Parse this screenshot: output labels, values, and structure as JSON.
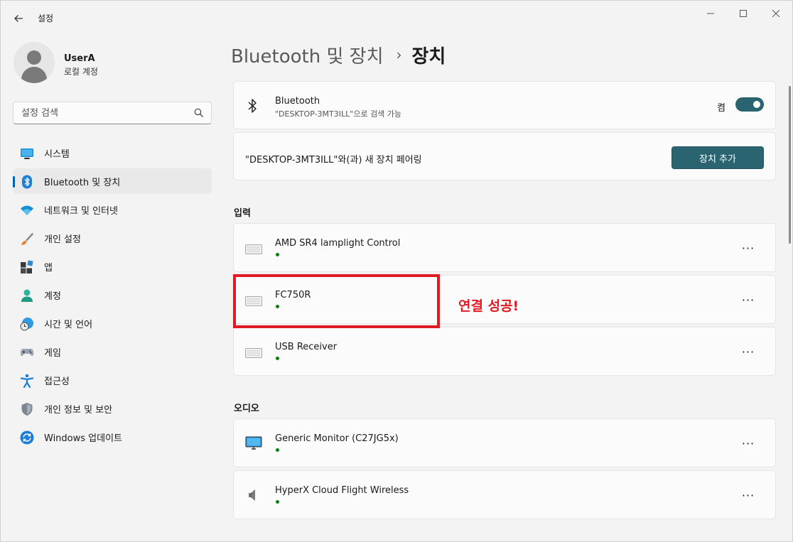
{
  "window": {
    "title": "설정",
    "back_icon": "arrow-left-icon",
    "controls": [
      "minimize-icon",
      "maximize-icon",
      "close-icon"
    ]
  },
  "user": {
    "name": "UserA",
    "account_type": "로컬 계정"
  },
  "search": {
    "placeholder": "설정 검색"
  },
  "nav": {
    "items": [
      {
        "label": "시스템",
        "icon": "system-icon",
        "active": false
      },
      {
        "label": "Bluetooth 및 장치",
        "icon": "bluetooth-icon",
        "active": true
      },
      {
        "label": "네트워크 및 인터넷",
        "icon": "wifi-icon",
        "active": false
      },
      {
        "label": "개인 설정",
        "icon": "brush-icon",
        "active": false
      },
      {
        "label": "앱",
        "icon": "apps-icon",
        "active": false
      },
      {
        "label": "계정",
        "icon": "account-icon",
        "active": false
      },
      {
        "label": "시간 및 언어",
        "icon": "time-language-icon",
        "active": false
      },
      {
        "label": "게임",
        "icon": "gamepad-icon",
        "active": false
      },
      {
        "label": "접근성",
        "icon": "accessibility-icon",
        "active": false
      },
      {
        "label": "개인 정보 및 보안",
        "icon": "shield-icon",
        "active": false
      },
      {
        "label": "Windows 업데이트",
        "icon": "update-icon",
        "active": false
      }
    ]
  },
  "breadcrumb": {
    "parent": "Bluetooth 및 장치",
    "separator": "›",
    "current": "장치"
  },
  "bluetooth": {
    "title": "Bluetooth",
    "subtitle": "\"DESKTOP-3MT3ILL\"으로 검색 가능",
    "toggle_label": "켬",
    "toggle_on": true
  },
  "pairing": {
    "text": "\"DESKTOP-3MT3ILL\"와(과) 새 장치 페어링",
    "button": "장치 추가"
  },
  "sections": {
    "input": {
      "title": "입력",
      "devices": [
        {
          "name": "AMD SR4 lamplight Control",
          "icon": "keyboard-icon",
          "connected": true
        },
        {
          "name": "FC750R",
          "icon": "keyboard-icon",
          "connected": true
        },
        {
          "name": "USB Receiver",
          "icon": "keyboard-icon",
          "connected": true
        }
      ]
    },
    "audio": {
      "title": "오디오",
      "devices": [
        {
          "name": "Generic Monitor (C27JG5x)",
          "icon": "monitor-icon",
          "connected": true
        },
        {
          "name": "HyperX Cloud Flight Wireless",
          "icon": "speaker-icon",
          "connected": true
        }
      ]
    }
  },
  "more_glyph": "···",
  "annotation": {
    "text": "연결 성공!"
  },
  "colors": {
    "accent": "#2a6470",
    "connected": "#107c10",
    "annotation": "#e01b24",
    "nav_indicator": "#005fb8"
  }
}
